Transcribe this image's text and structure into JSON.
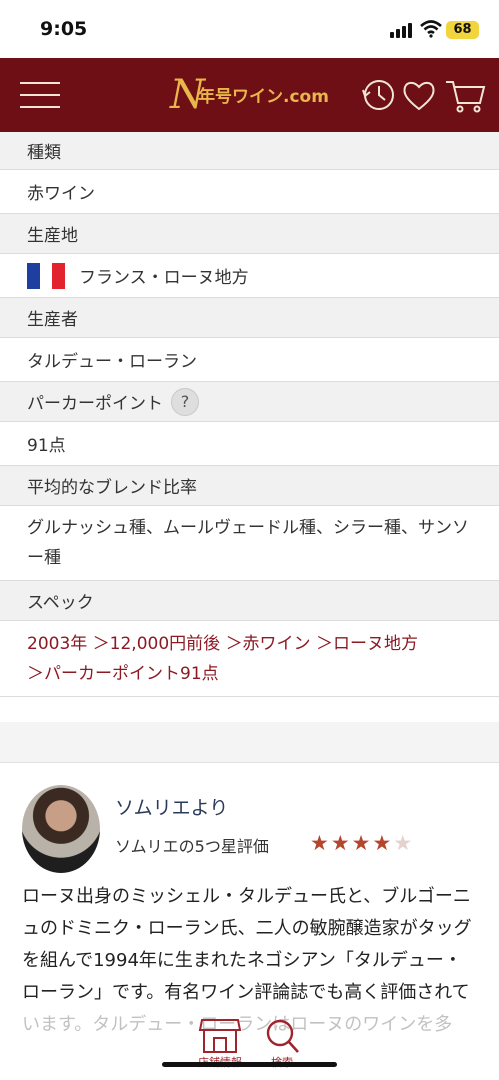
{
  "status": {
    "time": "9:05",
    "battery": "68"
  },
  "header": {
    "logo_text": "年号ワイン.com"
  },
  "details": {
    "type_label": "種類",
    "type_value": "赤ワイン",
    "origin_label": "生産地",
    "origin_value": "フランス・ローヌ地方",
    "producer_label": "生産者",
    "producer_value": "タルデュー・ローラン",
    "parker_label": "パーカーポイント",
    "parker_help": "?",
    "parker_value": "91点",
    "blend_label": "平均的なブレンド比率",
    "blend_value": "グルナッシュ種、ムールヴェードル種、シラー種、サンソー種",
    "spec_label": "スペック",
    "spec_links": [
      "2003年",
      "＞12,000円前後",
      "＞赤ワイン",
      "＞ローヌ地方",
      "＞パーカーポイント91点"
    ]
  },
  "sommelier": {
    "title": "ソムリエより",
    "rating_label": "ソムリエの5つ星評価",
    "rating": 4,
    "rating_max": 5,
    "body": "ローヌ出身のミッシェル・タルデュー氏と、ブルゴーニュのドミニク・ローラン氏、二人の敏腕醸造家がタッグを組んで1994年に生まれたネゴシアン「タルデュー・ローラン」です。有名ワイン評論誌でも高く評価されています。タルデュー・ローランはローヌのワインを多"
  },
  "bottom_bar": {
    "store_label": "店舗情報",
    "search_label": "検索"
  },
  "colors": {
    "header_bg": "#6e0f16",
    "accent": "#8b1a23",
    "gold": "#e8b64a",
    "star": "#b5462e"
  },
  "flag_colors": [
    "#1f3fa0",
    "#ffffff",
    "#e2222c"
  ]
}
